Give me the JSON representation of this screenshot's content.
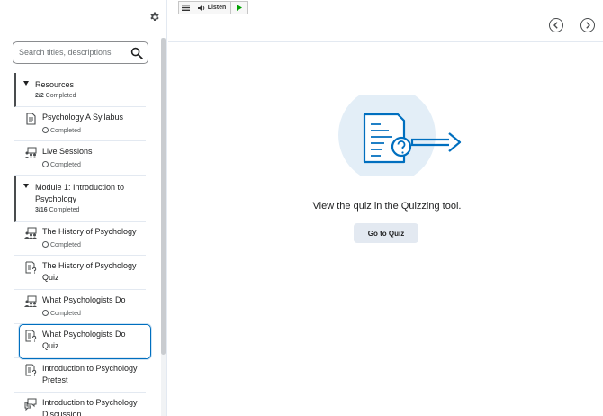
{
  "toolbar": {
    "listen_label": "Listen"
  },
  "search": {
    "placeholder": "Search titles, descriptions"
  },
  "toc": {
    "resources": {
      "title": "Resources",
      "count": "2/2",
      "count_suffix": " Completed"
    },
    "syllabus": {
      "title": "Psychology A Syllabus",
      "status": "Completed"
    },
    "live": {
      "title": "Live Sessions",
      "status": "Completed"
    },
    "module1": {
      "title": "Module 1: Introduction to Psychology",
      "count": "3/16",
      "count_suffix": " Completed"
    },
    "history": {
      "title": "The History of Psychology",
      "status": "Completed"
    },
    "history_quiz": {
      "title": "The History of Psychology Quiz"
    },
    "what_do": {
      "title": "What Psychologists Do",
      "status": "Completed"
    },
    "what_do_quiz": {
      "title": "What Psychologists Do Quiz"
    },
    "pretest": {
      "title": "Introduction to Psychology Pretest"
    },
    "discussion": {
      "title": "Introduction to Psychology Discussion"
    }
  },
  "main": {
    "message": "View the quiz in the Quizzing tool.",
    "go_button": "Go to Quiz"
  },
  "icons": {
    "settings": "gear-icon",
    "search": "search-icon",
    "previous": "chevron-left-icon",
    "next": "chevron-right-icon",
    "document": "document-icon",
    "live": "people-screen-icon",
    "quiz": "quiz-icon",
    "discussion": "discussion-icon"
  },
  "colors": {
    "accent": "#006fbf",
    "button_bg": "#e3e9f1",
    "illustration_circle": "#e3eef7",
    "play_green": "#00a000"
  }
}
